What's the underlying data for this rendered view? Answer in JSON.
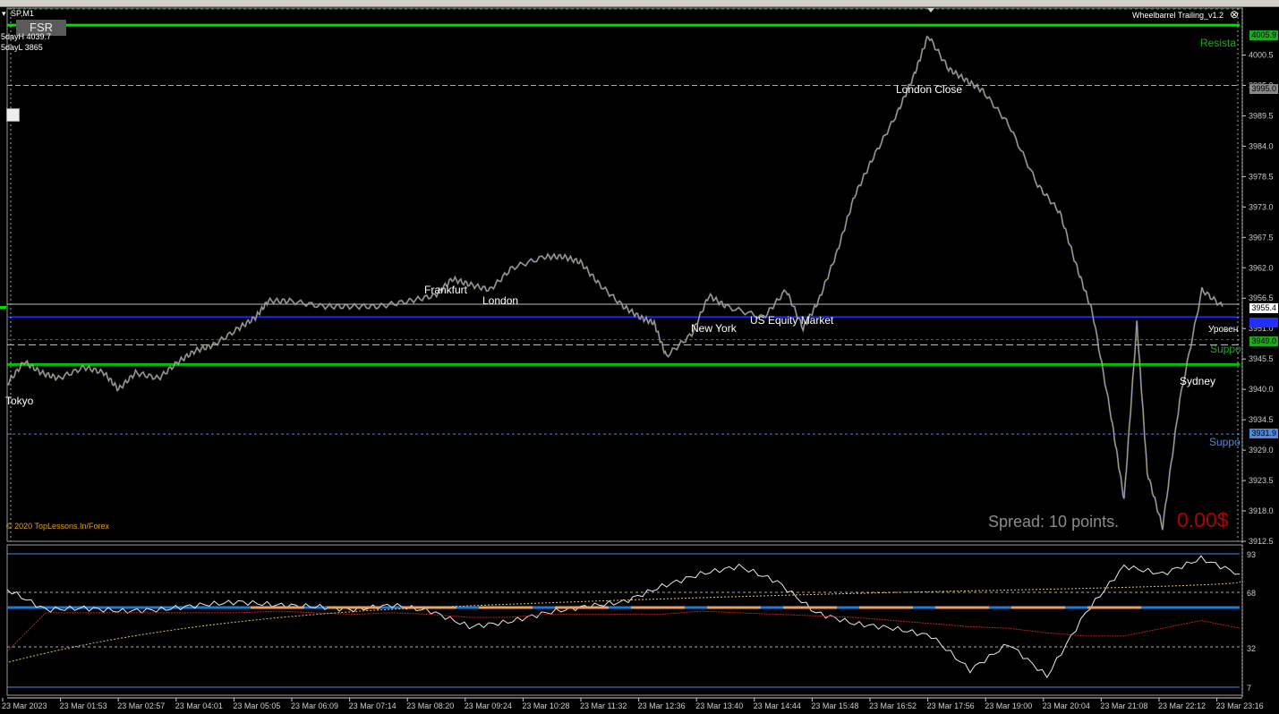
{
  "window": {
    "symbol_title": "SP,M1",
    "indicator_name": "Wheelbarrel Trailing_v1.2"
  },
  "buttons": {
    "fsr": "FSR"
  },
  "info": {
    "day_high": "5dayH 4039.7",
    "day_low": "5dayL 3865",
    "copyright": "© 2020 TopLessons.In/Forex",
    "spread": "Spread: 10 points.",
    "profit": "0.00$"
  },
  "sessions": {
    "tokyo": "Tokyo",
    "frankfurt": "Frankfurt",
    "london": "London",
    "new_york": "New York",
    "us_equity": "US Equity Market",
    "london_close": "London Close",
    "sydney": "Sydney"
  },
  "level_labels": {
    "resistance": "Resista",
    "support1": "Suppo",
    "support2": "Suppo",
    "level_ru": "Уровен"
  },
  "price_axis": {
    "ticks": [
      "4000.5",
      "3995.0",
      "3989.5",
      "3984.0",
      "3978.5",
      "3973.0",
      "3967.5",
      "3962.0",
      "3956.5",
      "3951.0",
      "3945.5",
      "3940.0",
      "3934.5",
      "3929.0",
      "3923.5",
      "3918.0",
      "3912.5"
    ],
    "tags": {
      "resistance": "4005.9",
      "level_3995": "3995.0",
      "current": "3955.4",
      "blue_level": "3953.1",
      "support_green": "3949.0",
      "support_blue": "3931.9"
    }
  },
  "oscillator_axis": {
    "ticks": [
      "93",
      "68",
      "32",
      "7"
    ]
  },
  "time_axis": {
    "ticks": [
      "23 Mar 2023",
      "23 Mar 01:53",
      "23 Mar 02:57",
      "23 Mar 04:01",
      "23 Mar 05:05",
      "23 Mar 06:09",
      "23 Mar 07:14",
      "23 Mar 08:20",
      "23 Mar 09:24",
      "23 Mar 10:28",
      "23 Mar 11:32",
      "23 Mar 12:36",
      "23 Mar 13:40",
      "23 Mar 14:44",
      "23 Mar 15:48",
      "23 Mar 16:52",
      "23 Mar 17:56",
      "23 Mar 19:00",
      "23 Mar 20:04",
      "23 Mar 21:08",
      "23 Mar 22:12",
      "23 Mar 23:16"
    ]
  },
  "colors": {
    "resistance": "#00e000",
    "support": "#00c000",
    "blue_level": "#2030ff",
    "support_blue": "#4a8ae0",
    "price_line": "#9aa0c8",
    "profit": "#b20000"
  },
  "chart_data": {
    "type": "line",
    "title": "SP,M1",
    "price_series": [
      [
        "00:00",
        3941
      ],
      [
        "00:20",
        3945
      ],
      [
        "00:40",
        3943
      ],
      [
        "01:00",
        3942
      ],
      [
        "01:30",
        3944
      ],
      [
        "01:53",
        3943
      ],
      [
        "02:10",
        3940
      ],
      [
        "02:30",
        3943
      ],
      [
        "02:57",
        3942
      ],
      [
        "03:20",
        3945
      ],
      [
        "03:40",
        3947
      ],
      [
        "04:01",
        3948
      ],
      [
        "04:30",
        3951
      ],
      [
        "04:50",
        3953
      ],
      [
        "05:05",
        3956
      ],
      [
        "05:30",
        3956
      ],
      [
        "06:09",
        3955
      ],
      [
        "06:40",
        3955
      ],
      [
        "07:14",
        3955
      ],
      [
        "07:50",
        3956
      ],
      [
        "08:20",
        3957
      ],
      [
        "08:40",
        3960
      ],
      [
        "09:00",
        3959
      ],
      [
        "09:24",
        3958
      ],
      [
        "09:50",
        3962
      ],
      [
        "10:28",
        3964
      ],
      [
        "10:50",
        3964
      ],
      [
        "11:10",
        3963
      ],
      [
        "11:32",
        3959
      ],
      [
        "12:00",
        3955
      ],
      [
        "12:20",
        3953
      ],
      [
        "12:36",
        3952
      ],
      [
        "12:50",
        3946
      ],
      [
        "13:20",
        3950
      ],
      [
        "13:40",
        3957
      ],
      [
        "14:00",
        3955
      ],
      [
        "14:44",
        3953
      ],
      [
        "15:10",
        3958
      ],
      [
        "15:30",
        3951
      ],
      [
        "15:48",
        3956
      ],
      [
        "16:10",
        3965
      ],
      [
        "16:30",
        3975
      ],
      [
        "16:52",
        3982
      ],
      [
        "17:20",
        3990
      ],
      [
        "17:40",
        3997
      ],
      [
        "17:56",
        4004
      ],
      [
        "18:20",
        3998
      ],
      [
        "18:40",
        3996
      ],
      [
        "19:00",
        3994
      ],
      [
        "19:30",
        3988
      ],
      [
        "20:04",
        3977
      ],
      [
        "20:30",
        3972
      ],
      [
        "20:50",
        3962
      ],
      [
        "21:08",
        3954
      ],
      [
        "21:30",
        3935
      ],
      [
        "21:45",
        3920
      ],
      [
        "22:00",
        3952
      ],
      [
        "22:12",
        3925
      ],
      [
        "22:30",
        3915
      ],
      [
        "22:50",
        3938
      ],
      [
        "23:16",
        3958
      ],
      [
        "23:40",
        3955
      ]
    ],
    "levels": {
      "resistance": 4005.9,
      "level_3995": 3995.0,
      "current": 3955.4,
      "blue_level": 3953.1,
      "support_green": 3949.0,
      "support_main": 3944.5,
      "support_blue": 3931.9
    },
    "ylim": [
      3912.5,
      4009
    ],
    "oscillator": {
      "ylim": [
        0,
        100
      ],
      "levels": [
        93,
        68,
        50,
        32,
        7
      ],
      "white_series": [
        70,
        57,
        58,
        56,
        57,
        60,
        62,
        60,
        59,
        57,
        60,
        56,
        46,
        49,
        55,
        59,
        62,
        72,
        80,
        85,
        75,
        55,
        48,
        45,
        40,
        18,
        35,
        14,
        55,
        85,
        80,
        90,
        80
      ],
      "red_series": [
        30,
        55,
        55,
        55,
        55,
        55,
        55,
        56,
        55,
        54,
        55,
        54,
        52,
        52,
        54,
        54,
        54,
        54,
        56,
        55,
        54,
        53,
        52,
        50,
        48,
        46,
        45,
        42,
        40,
        40,
        45,
        50,
        45
      ]
    }
  }
}
